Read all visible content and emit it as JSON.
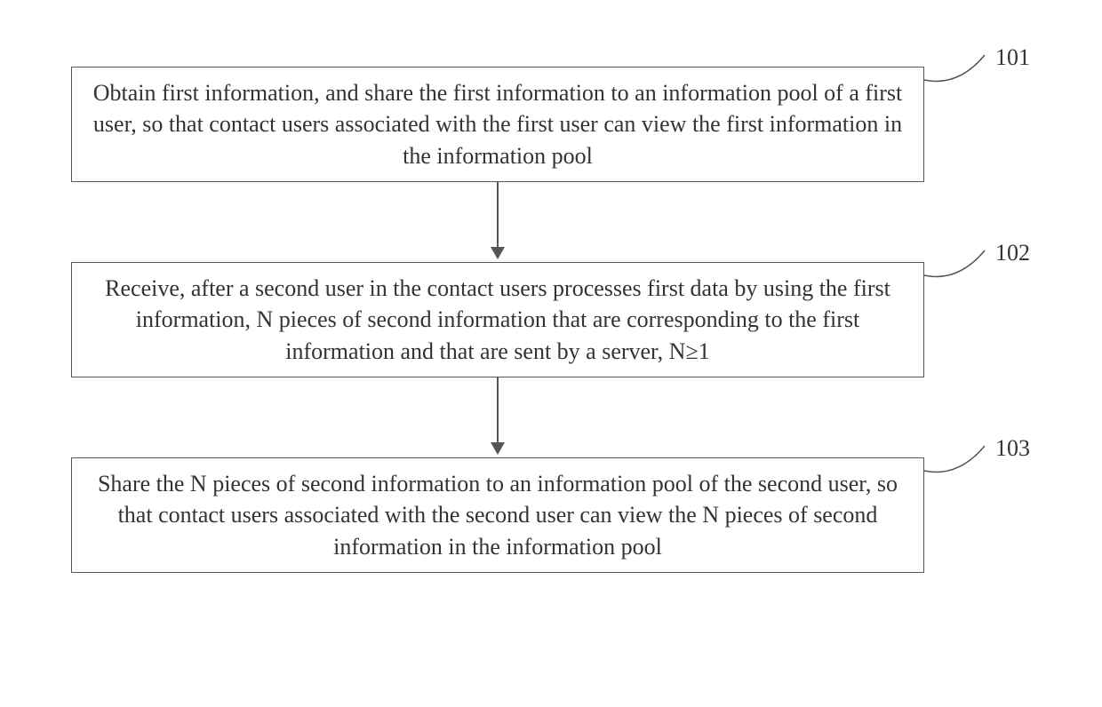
{
  "steps": [
    {
      "id": "101",
      "text": "Obtain first information, and share the first information to an information pool of a first user, so that contact users associated with the first user can view the first information in the information pool"
    },
    {
      "id": "102",
      "text": "Receive, after a second user in the contact users processes first data by using the first information, N pieces of second information that are corresponding to the first information and that are sent by a server, N≥1"
    },
    {
      "id": "103",
      "text": "Share the N pieces of second information to an information pool of the second user, so that contact users associated with the second user can view the N pieces of second information in the information pool"
    }
  ]
}
